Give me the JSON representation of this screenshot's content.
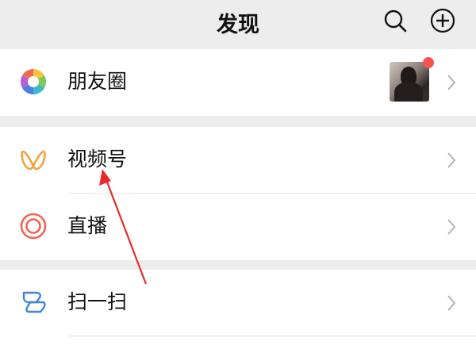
{
  "header": {
    "title": "发现",
    "search_icon": "search-icon",
    "add_icon": "add-circle-icon"
  },
  "groups": [
    {
      "items": [
        {
          "label": "朋友圈",
          "icon": "moments-aperture-icon",
          "badge": "red-dot",
          "has_thumbnail": true
        }
      ]
    },
    {
      "items": [
        {
          "label": "视频号",
          "icon": "channels-butterfly-icon"
        },
        {
          "label": "直播",
          "icon": "live-ring-icon"
        }
      ]
    },
    {
      "items": [
        {
          "label": "扫一扫",
          "icon": "scan-icon"
        }
      ]
    }
  ],
  "colors": {
    "background": "#ededed",
    "badge_red": "#fa5151",
    "channels_orange": "#f5a33f",
    "live_red": "#f06552",
    "scan_blue": "#3d86d8",
    "annotation_arrow": "#e52b2b"
  }
}
